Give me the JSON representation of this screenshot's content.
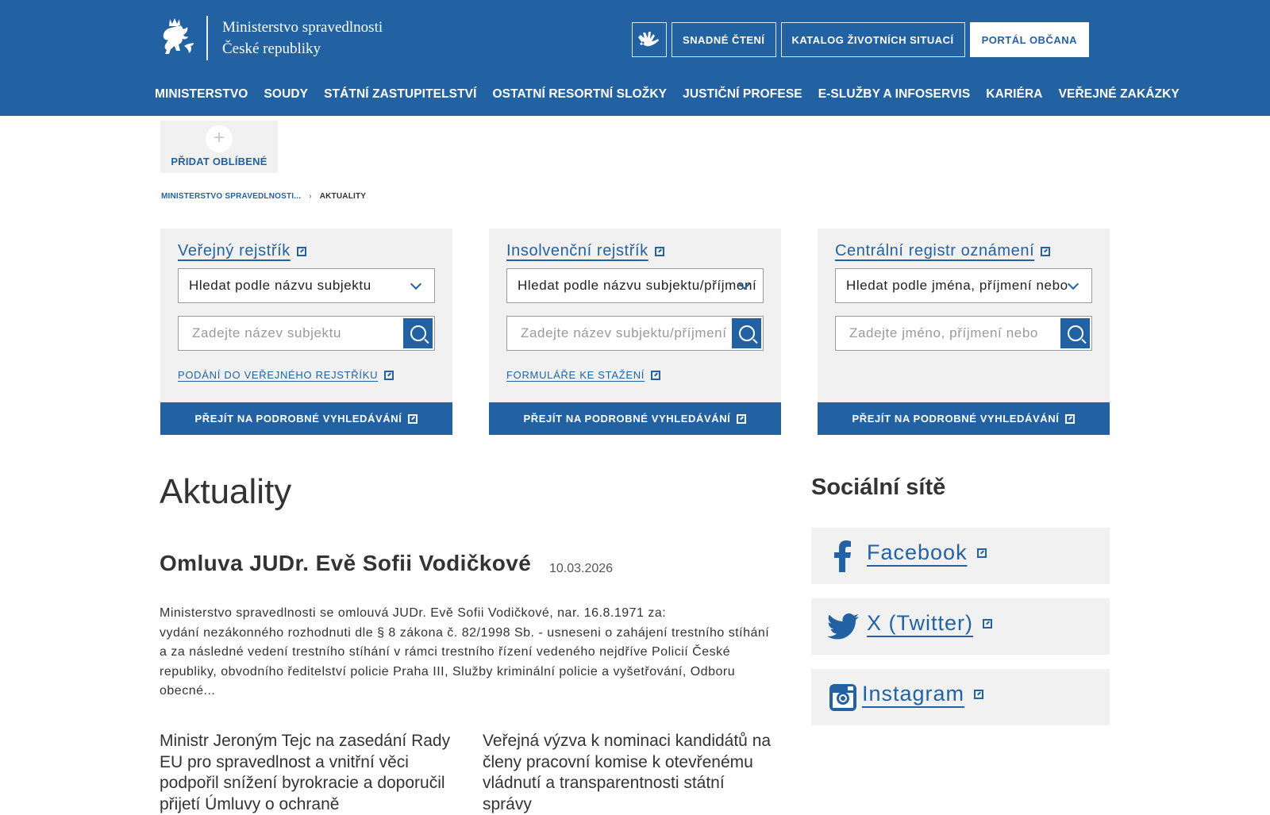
{
  "header": {
    "logo_line1": "Ministerstvo spravedlnosti",
    "logo_line2": "České republiky",
    "sign_language_icon": "sign-language-hands-icon",
    "easy_reading": "SNADNÉ ČTENÍ",
    "life_situations": "KATALOG ŽIVOTNÍCH SITUACÍ",
    "citizen_portal": "PORTÁL OBČANA",
    "brand_color": "#2362a2"
  },
  "nav": {
    "items": [
      "MINISTERSTVO",
      "SOUDY",
      "STÁTNÍ ZASTUPITELSTVÍ",
      "OSTATNÍ RESORTNÍ SLOŽKY",
      "JUSTIČNÍ PROFESE",
      "E-SLUŽBY A INFOSERVIS",
      "KARIÉRA",
      "VEŘEJNÉ ZAKÁZKY"
    ]
  },
  "favorite": {
    "label": "PŘIDAT OBLÍBENÉ"
  },
  "breadcrumb": {
    "home": "MINISTERSTVO SPRAVEDLNOSTI...",
    "separator": "›",
    "current": "AKTUALITY"
  },
  "registries": [
    {
      "title": "Veřejný rejstřík",
      "select_value": "Hledat podle názvu subjektu",
      "search_placeholder": "Zadejte název subjektu",
      "link": "PODÁNÍ DO VEŘEJNÉHO REJSTŘÍKU",
      "button": "PŘEJÍT NA PODROBNÉ VYHLEDÁVÁNÍ"
    },
    {
      "title": "Insolvenční rejstřík",
      "select_value": "Hledat podle názvu subjektu/příjmení",
      "search_placeholder": "Zadejte název subjektu/příjmení",
      "link": "FORMULÁŘE KE STAŽENÍ",
      "button": "PŘEJÍT NA PODROBNÉ VYHLEDÁVÁNÍ"
    },
    {
      "title": "Centrální registr oznámení",
      "select_value": "Hledat podle jména, příjmení nebo",
      "search_placeholder": "Zadejte jméno, příjmení nebo",
      "link": "",
      "button": "PŘEJÍT NA PODROBNÉ VYHLEDÁVÁNÍ"
    }
  ],
  "news": {
    "heading": "Aktuality",
    "article": {
      "title": "Omluva JUDr. Evě Sofii Vodičkové",
      "date": "10.03.2026",
      "body_line1": "Ministerstvo spravedlnosti se omlouvá JUDr. Evě Sofii Vodičkové, nar. 16.8.1971 za:",
      "body_rest": "vydání nezákonného rozhodnuti dle § 8 zákona č. 82/1998 Sb. - usneseni o zahájení trestního stíhání a za následné vedení trestního stíhání v rámci trestního řízení vedeného nejdříve Policií České republiky, obvodního ředitelství policie Praha III, Služby kriminální policie a vyšetřování, Odboru obecné..."
    },
    "teasers": [
      "Ministr Jeroným Tejc na zasedání Rady EU pro spravedlnost a vnitřní věci podpořil snížení byrokracie a doporučil přijetí Úmluvy o ochraně",
      "Veřejná výzva k nominaci kandidátů na členy pracovní komise k otevřenému vládnutí a transparentnosti státní správy"
    ]
  },
  "social": {
    "heading": "Sociální sítě",
    "items": [
      {
        "label": "Facebook",
        "icon": "facebook-icon"
      },
      {
        "label": "X (Twitter)",
        "icon": "twitter-bird-icon"
      },
      {
        "label": "Instagram",
        "icon": "instagram-icon"
      }
    ]
  }
}
